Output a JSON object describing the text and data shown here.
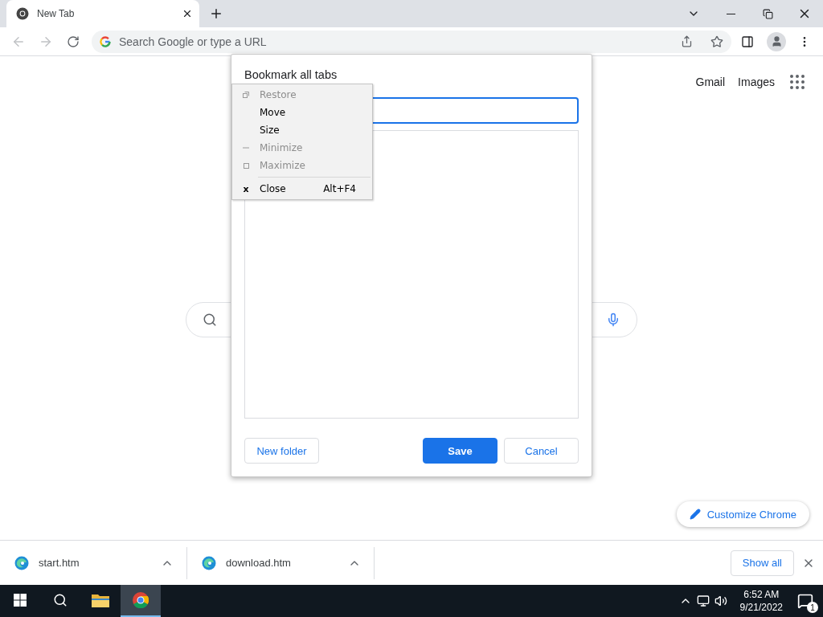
{
  "tabs": [
    {
      "title": "New Tab",
      "selected": true
    }
  ],
  "nav_buttons": [
    {
      "kind": "back",
      "disabled": true
    },
    {
      "kind": "forward",
      "disabled": true
    },
    {
      "kind": "reload",
      "disabled": false
    }
  ],
  "address_bar": {
    "placeholder": "Search Google or type a URL"
  },
  "header_links": [
    "Gmail",
    "Images"
  ],
  "customize_button": "Customize Chrome",
  "dialog": {
    "title": "Bookmark all tabs",
    "name_field_focused": true,
    "buttons": [
      {
        "label": "New folder",
        "kind": "secondary"
      },
      {
        "label": "Save",
        "kind": "primary"
      },
      {
        "label": "Cancel",
        "kind": "secondary"
      }
    ]
  },
  "system_menu": {
    "items": [
      {
        "label": "Restore",
        "kind": "restore",
        "disabled": true,
        "separator_before": false
      },
      {
        "label": "Move",
        "kind": "plain",
        "disabled": false,
        "separator_before": false
      },
      {
        "label": "Size",
        "kind": "plain",
        "disabled": false,
        "separator_before": false
      },
      {
        "label": "Minimize",
        "kind": "minimize",
        "disabled": true,
        "separator_before": false
      },
      {
        "label": "Maximize",
        "kind": "maximize",
        "disabled": true,
        "separator_before": false
      },
      {
        "label": "Close",
        "kind": "close",
        "icon_char": "x",
        "shortcut": "Alt+F4",
        "disabled": false,
        "separator_before": true
      }
    ]
  },
  "downloads": [
    {
      "file": "start.htm"
    },
    {
      "file": "download.htm"
    }
  ],
  "show_all": "Show all",
  "taskbar": {
    "apps": [
      {
        "kind": "start",
        "active": false
      },
      {
        "kind": "search",
        "active": false
      },
      {
        "kind": "explorer",
        "active": false
      },
      {
        "kind": "chrome",
        "active": true
      }
    ],
    "clock": {
      "time": "6:52 AM",
      "date": "9/21/2022"
    },
    "notifications": "1"
  }
}
